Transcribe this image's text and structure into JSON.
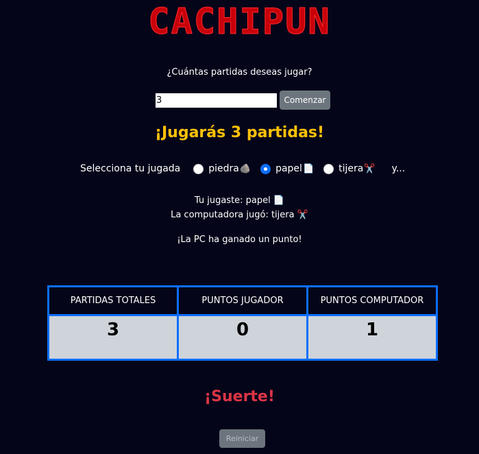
{
  "title": "CACHIPUN",
  "question": "¿Cuántas partidas deseas jugar?",
  "games_input": {
    "value": "3"
  },
  "start_button": "Comenzar",
  "announcement": "¡Jugarás 3 partidas!",
  "selection": {
    "label": "Selecciona tu jugada",
    "options": [
      {
        "label": "piedra",
        "emoji": "🪨",
        "checked": false
      },
      {
        "label": "papel",
        "emoji": "📄",
        "checked": true
      },
      {
        "label": "tijera",
        "emoji": "✂️",
        "checked": false
      }
    ],
    "trailing": "y..."
  },
  "result": {
    "player": "Tu jugaste: papel",
    "player_emoji": "📄",
    "computer": "La computadora jugó: tijera",
    "computer_emoji": "✂️",
    "message": "¡La PC ha ganado un punto!"
  },
  "scoreboard": {
    "headers": [
      "PARTIDAS TOTALES",
      "PUNTOS JUGADOR",
      "PUNTOS COMPUTADOR"
    ],
    "values": [
      "3",
      "0",
      "1"
    ]
  },
  "luck": "¡Suerte!",
  "reset_button": "Reiniciar",
  "colors": {
    "background": "#05051a",
    "title": "#c8000a",
    "announcement": "#ffc107",
    "luck": "#dc3545",
    "table_border": "#0d6efd",
    "radio_checked": "#0d6efd"
  }
}
